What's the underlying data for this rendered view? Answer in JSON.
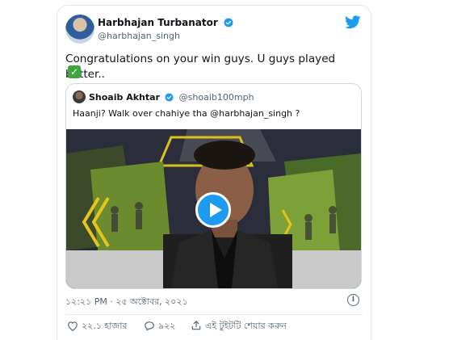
{
  "tweet": {
    "author_name": "Harbhajan Turbanator",
    "author_handle": "@harbhajan_singh",
    "text": "Congratulations on your win guys. U guys played better..",
    "check_emoji": "✓",
    "timestamp": "১২:২১ PM · ২৫ অক্টোবর, ২০২১"
  },
  "quoted": {
    "author_name": "Shoaib Akhtar",
    "author_handle": "@shoaib100mph",
    "text": "Haanji? Walk over chahiye tha @harbhajan_singh ?"
  },
  "actions": {
    "likes": "২২.১ হাজার",
    "replies": "৯২২",
    "share": "এই টুইটটি শেয়ার করুন"
  },
  "icons": {
    "brand": "twitter-bird-icon",
    "verified": "verified-badge-icon",
    "play": "play-icon",
    "info": "info-icon",
    "like": "heart-icon",
    "reply": "reply-bubble-icon",
    "share": "share-icon"
  },
  "colors": {
    "accent": "#1d9bf0",
    "text": "#0f1419",
    "muted": "#536471",
    "check": "#3fa53f"
  }
}
